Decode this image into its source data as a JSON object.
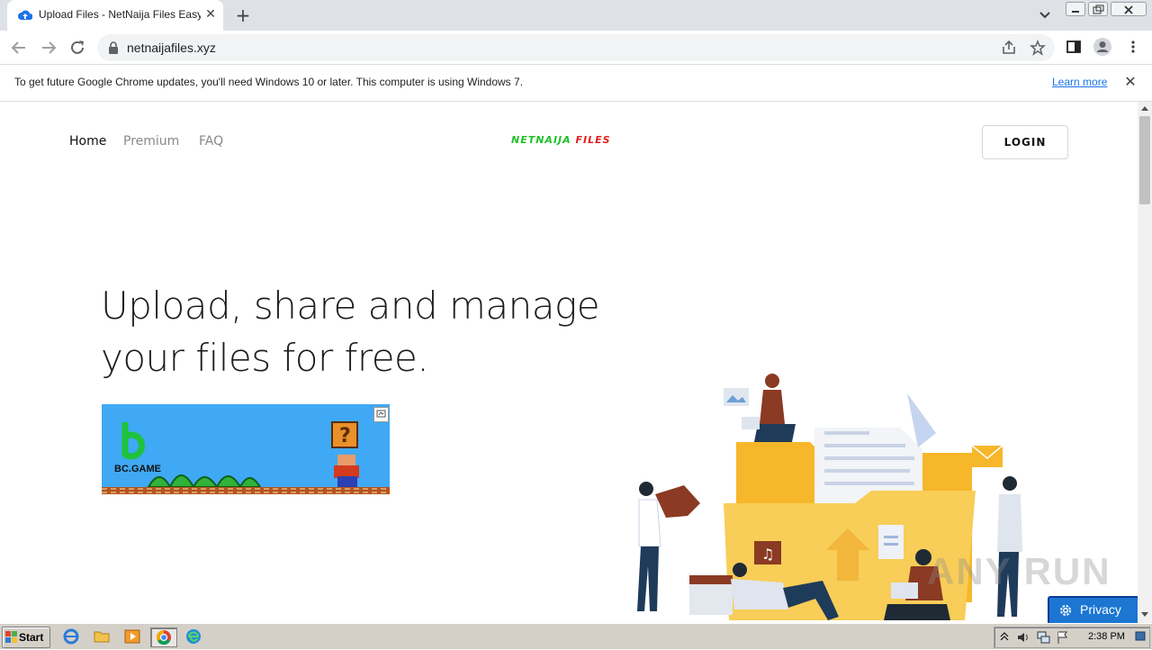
{
  "browser": {
    "tab_title": "Upload Files - NetNaija Files Easy Ac",
    "url": "netnaijafiles.xyz",
    "new_tab_glyph": "+",
    "tab_close_glyph": "✕"
  },
  "infobar": {
    "message": "To get future Google Chrome updates, you'll need Windows 10 or later. This computer is using Windows 7.",
    "learn_more": "Learn more",
    "close_glyph": "✕"
  },
  "nav": {
    "items": [
      {
        "label": "Home",
        "color": "#111111"
      },
      {
        "label": "Premium",
        "color": "#888888"
      },
      {
        "label": "FAQ",
        "color": "#888888"
      }
    ],
    "logo_part1": "NETNAIJA",
    "logo_part2": "FILES",
    "login": "LOGIN"
  },
  "hero": {
    "line1": "Upload, share and manage",
    "line2": "your files for free."
  },
  "ad": {
    "brand": "BC.GAME"
  },
  "watermark": "ANY RUN",
  "privacy": {
    "label": "Privacy"
  },
  "taskbar": {
    "start": "Start",
    "time": "2:38 PM"
  },
  "colors": {
    "logo_green": "#22c02a",
    "logo_red": "#e01f1f",
    "privacy_blue": "#1c76d2",
    "link_blue": "#1a73e8"
  }
}
